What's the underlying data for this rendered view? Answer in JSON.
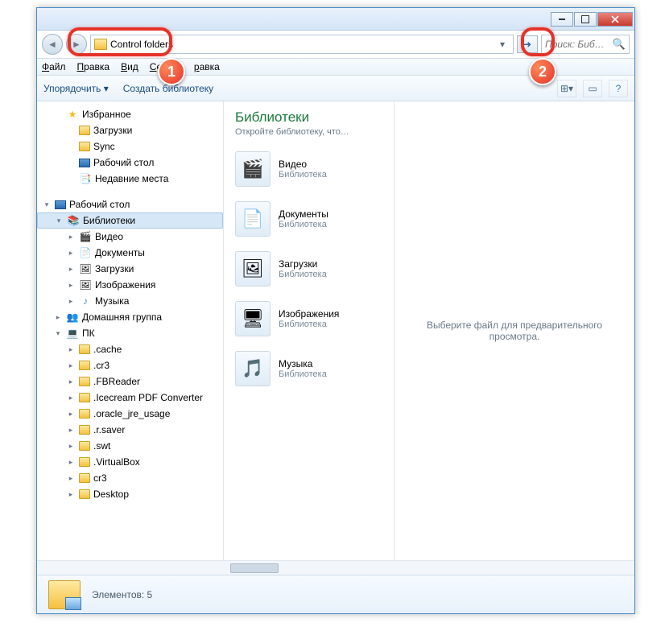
{
  "address_value": "Control folders",
  "search_placeholder": "Поиск: Биб…",
  "menu": {
    "file": "Файл",
    "edit": "Правка",
    "view": "Вид",
    "service": "Сервис",
    "help": "равка"
  },
  "toolbar": {
    "organize": "Упорядочить ▾",
    "newlib": "Создать библиотеку"
  },
  "sidebar": {
    "fav": "Избранное",
    "downloads": "Загрузки",
    "sync": "Sync",
    "desktop": "Рабочий стол",
    "recent": "Недавние места",
    "desktop2": "Рабочий стол",
    "libraries": "Библиотеки",
    "video": "Видео",
    "documents": "Документы",
    "downloads2": "Загрузки",
    "images": "Изображения",
    "music": "Музыка",
    "homegroup": "Домашняя группа",
    "pc": "ПК",
    "folders": [
      ".cache",
      ".cr3",
      ".FBReader",
      ".Icecream PDF Converter",
      ".oracle_jre_usage",
      ".r.saver",
      ".swt",
      ".VirtualBox",
      "cr3",
      "Desktop"
    ]
  },
  "main": {
    "title": "Библиотеки",
    "subtitle": "Откройте библиотеку, что…",
    "type_label": "Библиотека",
    "items": [
      {
        "name": "Видео",
        "icon": "🎬"
      },
      {
        "name": "Документы",
        "icon": "📄"
      },
      {
        "name": "Загрузки",
        "icon": "🖼"
      },
      {
        "name": "Изображения",
        "icon": "🖥"
      },
      {
        "name": "Музыка",
        "icon": "🎵"
      }
    ]
  },
  "preview_text": "Выберите файл для предварительного просмотра.",
  "status_text": "Элементов: 5",
  "callouts": {
    "1": "1",
    "2": "2"
  }
}
